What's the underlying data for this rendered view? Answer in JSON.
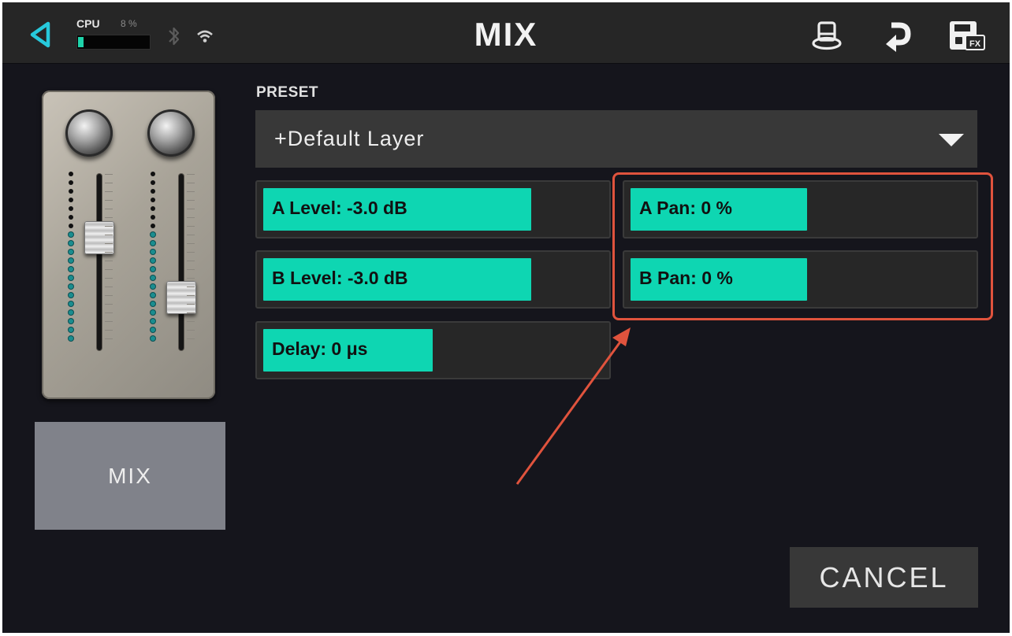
{
  "topbar": {
    "title": "MIX",
    "cpu_label": "CPU",
    "cpu_percent_text": "8 %",
    "cpu_load": 0.08,
    "icons": [
      "back-arrow-icon",
      "bluetooth-icon",
      "wifi-icon",
      "top-hat-icon",
      "return-arrow-icon",
      "fx-save-icon"
    ]
  },
  "left": {
    "mix_button_label": "MIX",
    "pedal_image": "mixer-pedal-with-two-knobs-and-two-faders"
  },
  "preset": {
    "label": "PRESET",
    "value": "+Default Layer"
  },
  "params": [
    {
      "id": "a-level",
      "label": "A Level: -3.0 dB",
      "fill": 0.76
    },
    {
      "id": "a-pan",
      "label": "A Pan: 0 %",
      "fill": 0.5
    },
    {
      "id": "b-level",
      "label": "B Level: -3.0 dB",
      "fill": 0.76
    },
    {
      "id": "b-pan",
      "label": "B Pan: 0 %",
      "fill": 0.5
    },
    {
      "id": "delay",
      "label": "Delay: 0 μs",
      "fill": 0.48
    }
  ],
  "cancel_label": "CANCEL",
  "colors": {
    "accent": "#0ed6b2",
    "back_icon": "#27c9dc",
    "annotation": "#e0533d",
    "background": "#15151c",
    "topbar": "#262626"
  }
}
